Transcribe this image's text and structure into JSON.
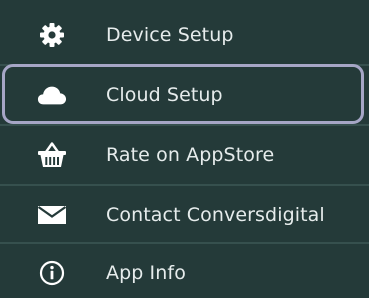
{
  "menu": {
    "items": [
      {
        "label": "Device Setup",
        "icon": "gear-icon",
        "selected": false
      },
      {
        "label": "Cloud Setup",
        "icon": "cloud-icon",
        "selected": true
      },
      {
        "label": "Rate on AppStore",
        "icon": "basket-icon",
        "selected": false
      },
      {
        "label": "Contact Conversdigital",
        "icon": "envelope-icon",
        "selected": false
      },
      {
        "label": "App Info",
        "icon": "info-icon",
        "selected": false
      }
    ]
  },
  "colors": {
    "background": "#243a39",
    "separator": "#36504e",
    "text": "#e6ecec",
    "selection_outline": "#a6a6c6"
  }
}
